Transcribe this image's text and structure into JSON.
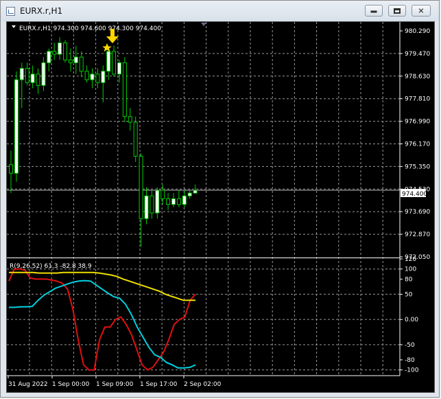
{
  "window": {
    "title": "EURX.r,H1",
    "minimize_label": "minimize",
    "maximize_label": "maximize",
    "close_label": "close"
  },
  "chart": {
    "header": "EURX.r,H1  974.300 974.600 974.300 974.400",
    "current_price_label": "974.400",
    "price_axis_labels": [
      "980.290",
      "979.470",
      "978.630",
      "977.810",
      "976.990",
      "976.170",
      "975.350",
      "974.530",
      "973.690",
      "972.870",
      "972.050"
    ],
    "indicator_header": "R(9,26,52) 61.3 -82.8 38.9",
    "indicator_axis_labels": [
      "120",
      "100",
      "80",
      "50",
      "0.00",
      "-50",
      "-80",
      "-100"
    ],
    "time_labels": [
      "31 Aug 2022",
      "1 Sep 00:00",
      "1 Sep 09:00",
      "1 Sep 17:00",
      "2 Sep 02:00"
    ]
  },
  "colors": {
    "background": "#000000",
    "bull_candle": "#ffffff",
    "bear_candle": "#000000",
    "candle_wick": "#00d000",
    "grid": "#9a9a9a",
    "red_line": "#e01010",
    "cyan_line": "#00d0e0",
    "yellow_line": "#f0e000",
    "marker": "#ffd700"
  },
  "markers": {
    "arrow_icon": "down-arrow-icon",
    "star_icon": "star-icon"
  },
  "chart_data": {
    "type": "candlestick",
    "price_ylim": [
      972.05,
      980.29
    ],
    "candles": [
      {
        "o": 975.3,
        "h": 975.8,
        "l": 974.3,
        "c": 975.0
      },
      {
        "o": 975.0,
        "h": 978.6,
        "l": 974.7,
        "c": 978.3
      },
      {
        "o": 978.3,
        "h": 978.9,
        "l": 977.3,
        "c": 978.7
      },
      {
        "o": 978.7,
        "h": 978.9,
        "l": 978.1,
        "c": 978.2
      },
      {
        "o": 978.2,
        "h": 978.8,
        "l": 978.0,
        "c": 978.5
      },
      {
        "o": 978.5,
        "h": 978.7,
        "l": 977.8,
        "c": 978.1
      },
      {
        "o": 978.1,
        "h": 979.1,
        "l": 977.9,
        "c": 978.9
      },
      {
        "o": 978.9,
        "h": 979.4,
        "l": 978.6,
        "c": 979.3
      },
      {
        "o": 979.3,
        "h": 979.6,
        "l": 979.0,
        "c": 979.2
      },
      {
        "o": 979.2,
        "h": 979.8,
        "l": 979.0,
        "c": 979.6
      },
      {
        "o": 979.6,
        "h": 979.7,
        "l": 978.9,
        "c": 979.0
      },
      {
        "o": 979.0,
        "h": 979.4,
        "l": 978.6,
        "c": 978.9
      },
      {
        "o": 978.9,
        "h": 979.5,
        "l": 978.5,
        "c": 979.1
      },
      {
        "o": 979.1,
        "h": 979.3,
        "l": 978.4,
        "c": 978.6
      },
      {
        "o": 978.6,
        "h": 978.8,
        "l": 978.2,
        "c": 978.3
      },
      {
        "o": 978.3,
        "h": 978.7,
        "l": 978.0,
        "c": 978.5
      },
      {
        "o": 978.5,
        "h": 978.7,
        "l": 978.0,
        "c": 978.2
      },
      {
        "o": 978.2,
        "h": 978.8,
        "l": 977.5,
        "c": 978.6
      },
      {
        "o": 978.6,
        "h": 979.4,
        "l": 978.3,
        "c": 979.3
      },
      {
        "o": 979.3,
        "h": 979.5,
        "l": 978.4,
        "c": 978.5
      },
      {
        "o": 978.5,
        "h": 979.0,
        "l": 978.2,
        "c": 978.9
      },
      {
        "o": 978.9,
        "h": 979.1,
        "l": 976.8,
        "c": 977.0
      },
      {
        "o": 977.0,
        "h": 977.3,
        "l": 976.5,
        "c": 976.8
      },
      {
        "o": 976.8,
        "h": 977.0,
        "l": 975.4,
        "c": 975.6
      },
      {
        "o": 975.6,
        "h": 975.7,
        "l": 972.4,
        "c": 973.4
      },
      {
        "o": 973.4,
        "h": 974.5,
        "l": 973.2,
        "c": 974.2
      },
      {
        "o": 974.2,
        "h": 974.4,
        "l": 973.4,
        "c": 973.6
      },
      {
        "o": 973.6,
        "h": 974.5,
        "l": 973.4,
        "c": 974.4
      },
      {
        "o": 974.4,
        "h": 974.6,
        "l": 973.9,
        "c": 974.1
      },
      {
        "o": 974.1,
        "h": 974.3,
        "l": 973.7,
        "c": 973.9
      },
      {
        "o": 973.9,
        "h": 974.3,
        "l": 973.8,
        "c": 974.1
      },
      {
        "o": 974.1,
        "h": 974.4,
        "l": 973.8,
        "c": 973.9
      },
      {
        "o": 973.9,
        "h": 974.4,
        "l": 973.8,
        "c": 974.2
      },
      {
        "o": 974.2,
        "h": 974.4,
        "l": 974.1,
        "c": 974.3
      },
      {
        "o": 974.3,
        "h": 974.6,
        "l": 974.3,
        "c": 974.4
      }
    ],
    "current_price": 974.4,
    "signal_candle_index": 18,
    "indicator": {
      "name": "R(9,26,52)",
      "ylim": [
        -110,
        120
      ],
      "series": [
        {
          "name": "R(9)",
          "color": "red",
          "values": [
            76,
            100,
            100,
            98,
            82,
            80,
            80,
            80,
            78,
            76,
            72,
            60,
            20,
            -40,
            -90,
            -100,
            -100,
            -40,
            -15,
            -15,
            0,
            5,
            -10,
            -30,
            -60,
            -90,
            -100,
            -95,
            -80,
            -65,
            -40,
            -10,
            0,
            5,
            38,
            50
          ]
        },
        {
          "name": "R(26)",
          "color": "cyan",
          "values": [
            24,
            24,
            25,
            25,
            26,
            38,
            48,
            55,
            62,
            66,
            70,
            74,
            76,
            77,
            76,
            68,
            60,
            52,
            45,
            42,
            30,
            10,
            -15,
            -35,
            -55,
            -70,
            -75,
            -85,
            -90,
            -96,
            -96,
            -95,
            -90
          ]
        },
        {
          "name": "R(52)",
          "color": "yellow",
          "values": [
            93,
            93,
            93,
            93,
            93,
            92,
            92,
            92,
            92,
            93,
            93,
            93,
            93,
            93,
            93,
            92,
            90,
            88,
            85,
            80,
            76,
            72,
            68,
            64,
            60,
            56,
            50,
            46,
            42,
            38,
            38,
            38
          ]
        }
      ]
    }
  }
}
